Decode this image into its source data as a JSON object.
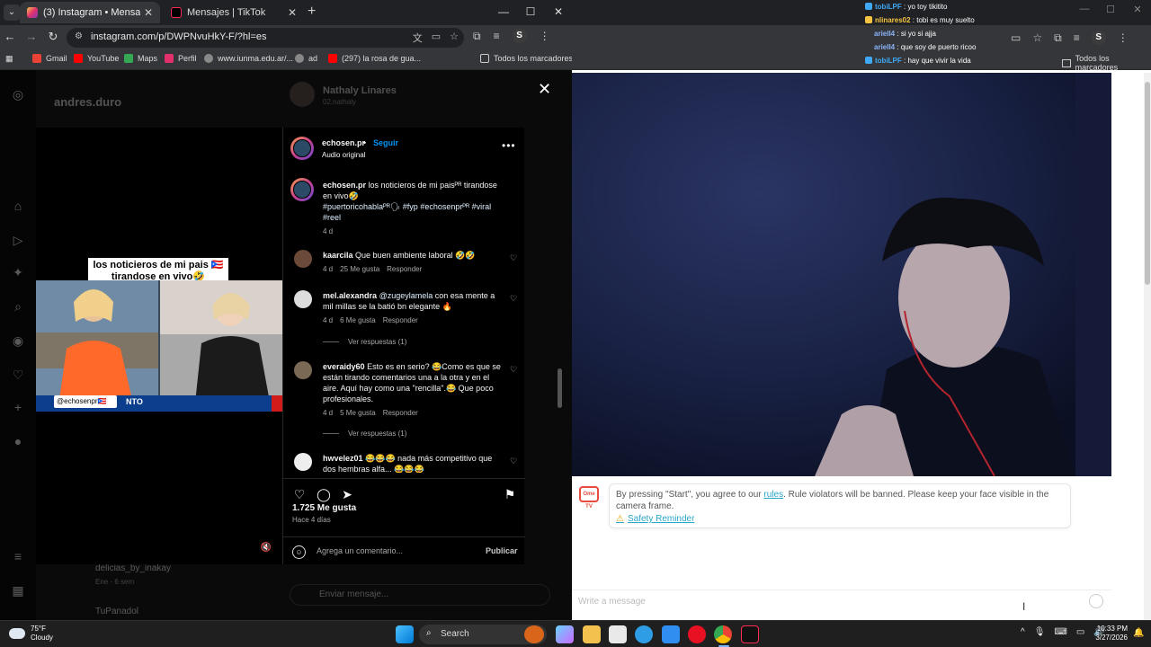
{
  "left_browser": {
    "tabs": [
      {
        "label": "(3) Instagram • Mensajes",
        "active": true
      },
      {
        "label": "Mensajes | TikTok",
        "active": false
      }
    ],
    "url": "instagram.com/p/DWPNvuHkY-F/?hl=es",
    "bookmarks": [
      "Gmail",
      "YouTube",
      "Maps",
      "Perfil",
      "www.iunma.edu.ar/...",
      "ad",
      "(297) la rosa de gua...",
      "Todos los marcadores"
    ]
  },
  "instagram": {
    "username": "andres.duro",
    "chat_name": "Nathaly Linares",
    "chat_sub": "02.nathaly",
    "notifications_badge": "3",
    "bottom_threads": [
      {
        "name": "delicias_by_inakay",
        "time": "Ene - 6 sem"
      },
      {
        "name": "TuPanadol"
      }
    ],
    "message_placeholder": "Enviar mensaje..."
  },
  "post": {
    "video_caption": "los noticieros de mi pais 🇵🇷 tirandose en vivo🤣",
    "video_watermark": "@echosenpr🇵🇷",
    "video_ticker": "NTO",
    "author": "echosen.pr",
    "follow": "Seguir",
    "audio": "Audio original",
    "caption_text": "los noticieros de mi paisᴾᴿ tirandose en vivo🤣",
    "caption_tags": "#puertoricohablaᴾᴿ🗣 #fyp #echosenprᴾᴿ #viral #reel",
    "caption_time": "4 d",
    "comments": [
      {
        "user": "kaarcila",
        "text": "Que buen ambiente laboral 🤣🤣",
        "time": "4 d",
        "likes": "25 Me gusta",
        "reply": "Responder"
      },
      {
        "user": "mel.alexandra",
        "mention": "@zugeylamela",
        "text": "con esa mente a mil millas se la batió bn elegante 🔥",
        "time": "4 d",
        "likes": "6 Me gusta",
        "reply": "Responder",
        "view_replies": "Ver respuestas (1)"
      },
      {
        "user": "everaidy60",
        "text": "Esto es en serio? 😂Como es que se están tirando comentarios una a la otra y en el aire. Aquí hay como una \"rencilla\".😂 Que poco profesionales.",
        "time": "4 d",
        "likes": "5 Me gusta",
        "reply": "Responder",
        "view_replies": "Ver respuestas (1)"
      },
      {
        "user": "hwvelez01",
        "text": "😂😂😂 nada más competitivo que dos hembras alfa... 😂😂😂"
      }
    ],
    "likes_total": "1.725 Me gusta",
    "posted": "Hace 4 días",
    "add_comment_placeholder": "Agrega un comentario...",
    "publish": "Publicar"
  },
  "right_browser": {
    "chat_overlay": [
      {
        "user": "tobiLPF",
        "text": "yo toy tikitito",
        "color": "#3fa9f5"
      },
      {
        "user": "nlinares02",
        "text": "tobi es muy suelto",
        "color": "#f5c542"
      },
      {
        "user": "ariell4",
        "text": "si yo si ajja",
        "color": "#8ab4f8"
      },
      {
        "user": "ariell4",
        "text": "que soy de puerto ricoo",
        "color": "#8ab4f8"
      },
      {
        "user": "tobiLPF",
        "text": "hay que vivir la vida",
        "color": "#3fa9f5"
      }
    ],
    "bookmarks_all": "Todos los marcadores",
    "notice_pre": "By pressing \"Start\", you agree to our ",
    "notice_link": "rules",
    "notice_post": ". Rule violators will be banned. Please keep your face visible in the camera frame.",
    "safety": "Safety Reminder",
    "logo": "Ome TV",
    "message_placeholder": "Write a message"
  },
  "taskbar": {
    "temp": "75°F",
    "condition": "Cloudy",
    "search": "Search",
    "time": "10:33 PM",
    "date": "3/27/2026"
  },
  "colors": {
    "ig_link": "#0095f6",
    "ome_link": "#2aa6c9",
    "ome_logo": "#e74c3c"
  }
}
